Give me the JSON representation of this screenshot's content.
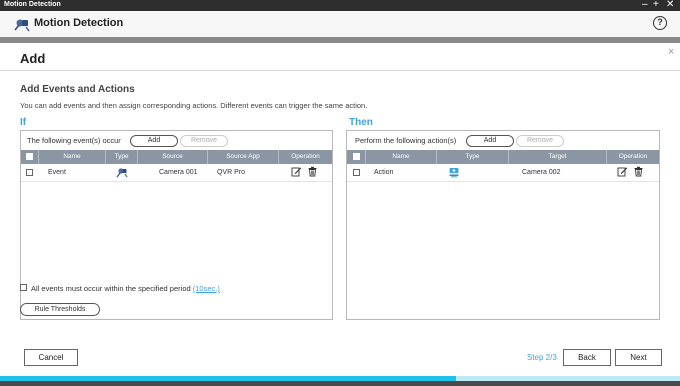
{
  "window": {
    "title": "Motion Detection",
    "controls": [
      "–",
      "+",
      "✕"
    ]
  },
  "app": {
    "title": "Motion Detection",
    "help_glyph": "?"
  },
  "dialog": {
    "title": "Add",
    "close_glyph": "×",
    "section_title": "Add Events and Actions",
    "description": "You can add events and then assign corresponding actions. Different events can trigger the same action.",
    "if_label": "If",
    "then_label": "Then",
    "events": {
      "bar_label": "The following event(s) occur",
      "add_label": "Add",
      "remove_label": "Remove",
      "columns": [
        "Name",
        "Type",
        "Source",
        "Source App",
        "Operation"
      ],
      "rows": [
        {
          "name": "Event",
          "type_icon": "motion-detection-icon",
          "source": "Camera 001",
          "source_app": "QVR Pro"
        }
      ]
    },
    "actions": {
      "bar_label": "Perform the following action(s)",
      "add_label": "Add",
      "remove_label": "Remove",
      "columns": [
        "Name",
        "Type",
        "Target",
        "Operation"
      ],
      "rows": [
        {
          "name": "Action",
          "type_icon": "camera-action-icon",
          "target": "Camera 002"
        }
      ]
    },
    "condition_text": "All events must occur within the specified period",
    "condition_link": "(10sec.)",
    "rule_thresholds_label": "Rule Thresholds",
    "cancel_label": "Cancel",
    "step_label": "Step 2/3",
    "back_label": "Back",
    "next_label": "Next"
  },
  "progress": {
    "fraction": 0.67
  },
  "colors": {
    "accent": "#3fa4d8",
    "table_header": "#8b96a4",
    "progress": "#1ec1e8"
  }
}
